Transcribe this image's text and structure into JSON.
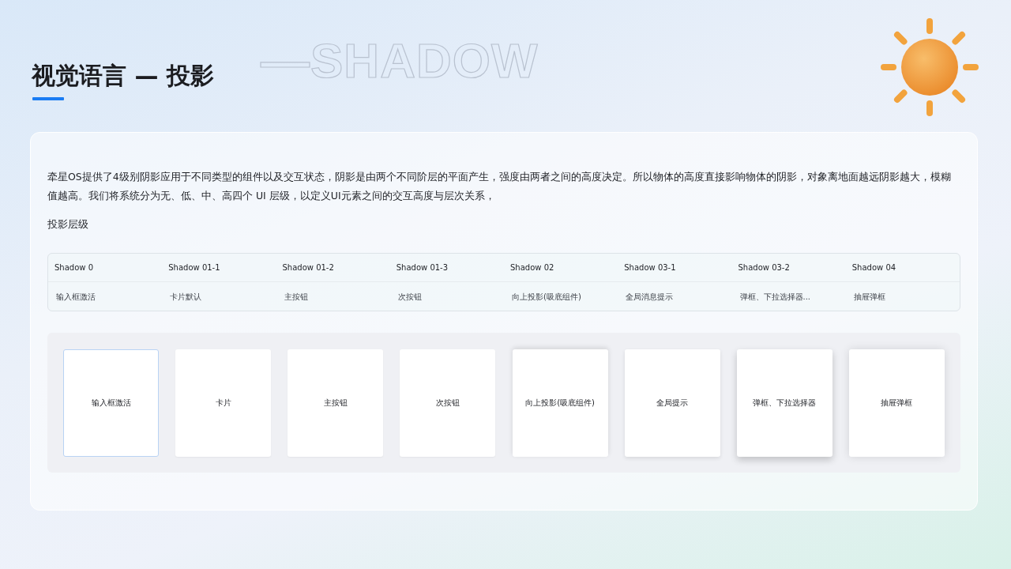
{
  "header": {
    "background_text": "—SHADOW",
    "title": "视觉语言 — 投影"
  },
  "intro": "牵星OS提供了4级别阴影应用于不同类型的组件以及交互状态，阴影是由两个不同阶层的平面产生，强度由两者之间的高度决定。所以物体的高度直接影响物体的阴影，对象离地面越远阴影越大，模糊值越高。我们将系统分为无、低、中、高四个 UI 层级，以定义UI元素之间的交互高度与层次关系，",
  "section_title": "投影层级",
  "table": {
    "columns": [
      "Shadow 0",
      "Shadow 01-1",
      "Shadow 01-2",
      "Shadow 01-3",
      "Shadow 02",
      "Shadow 03-1",
      "Shadow 03-2",
      "Shadow 04"
    ],
    "rows": [
      [
        "输入框激活",
        "卡片默认",
        "主按钮",
        "次按钮",
        "向上投影(吸底组件)",
        "全局消息提示",
        "弹框、下拉选择器...",
        "抽屉弹框"
      ]
    ]
  },
  "samples": [
    {
      "label": "输入框激活",
      "kind": "focus"
    },
    {
      "label": "卡片",
      "kind": "low"
    },
    {
      "label": "主按钮",
      "kind": "low"
    },
    {
      "label": "次按钮",
      "kind": "low"
    },
    {
      "label": "向上投影(吸底组件)",
      "kind": "upward"
    },
    {
      "label": "全局提示",
      "kind": "medium"
    },
    {
      "label": "弹框、下拉选择器",
      "kind": "high"
    },
    {
      "label": "抽屉弹框",
      "kind": "highest"
    }
  ]
}
